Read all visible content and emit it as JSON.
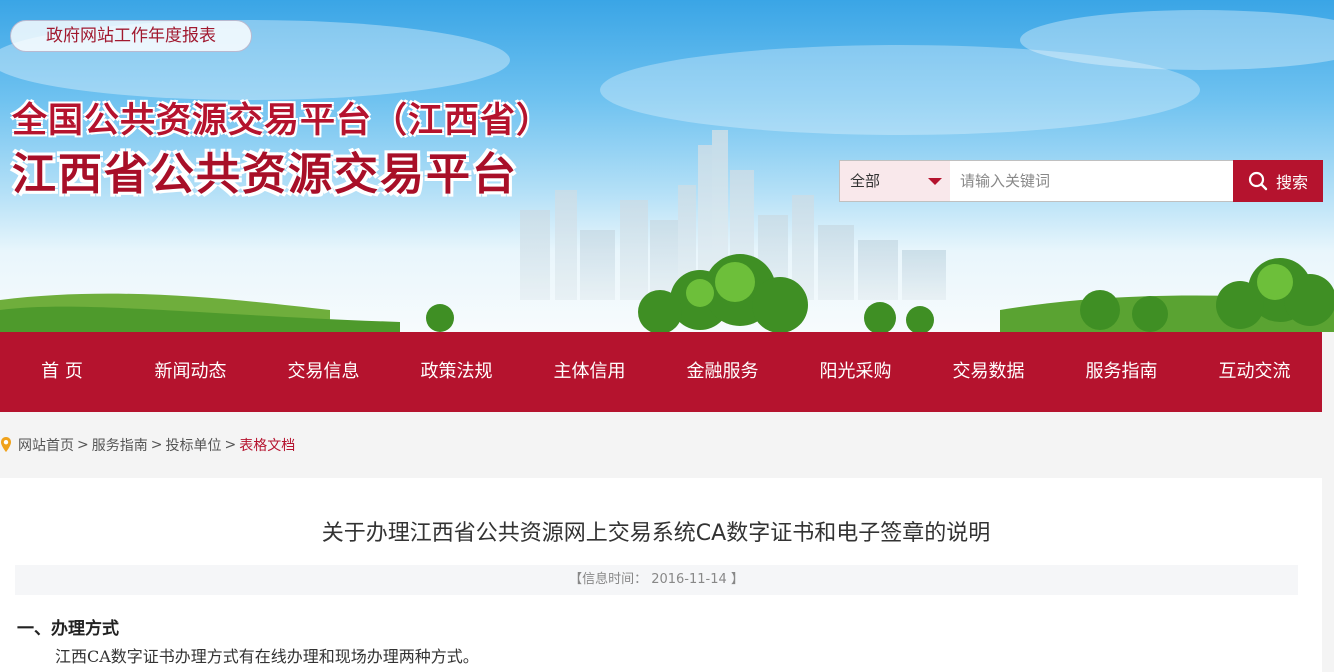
{
  "header": {
    "report_link": "政府网站工作年度报表",
    "title_line1": "全国公共资源交易平台（江西省）",
    "title_line2": "江西省公共资源交易平台"
  },
  "search": {
    "scope_selected": "全部",
    "placeholder": "请输入关键词",
    "value": "",
    "button_label": "搜索"
  },
  "nav": {
    "items": [
      {
        "label": "首 页"
      },
      {
        "label": "新闻动态"
      },
      {
        "label": "交易信息"
      },
      {
        "label": "政策法规"
      },
      {
        "label": "主体信用"
      },
      {
        "label": "金融服务"
      },
      {
        "label": "阳光采购"
      },
      {
        "label": "交易数据"
      },
      {
        "label": "服务指南"
      },
      {
        "label": "互动交流"
      }
    ]
  },
  "breadcrumb": {
    "items": [
      {
        "label": "网站首页"
      },
      {
        "label": "服务指南"
      },
      {
        "label": "投标单位"
      }
    ],
    "separator": ">",
    "current": "表格文档"
  },
  "article": {
    "title": "关于办理江西省公共资源网上交易系统CA数字证书和电子签章的说明",
    "info_label": "【信息时间：",
    "info_date": "2016-11-14",
    "info_close": "】",
    "section1_heading": "一、办理方式",
    "section1_paragraph": "江西CA数字证书办理方式有在线办理和现场办理两种方式。"
  },
  "colors": {
    "brand_red": "#b5132e",
    "select_bg": "#f9e8eb",
    "sky_top": "#3aa5e6"
  }
}
